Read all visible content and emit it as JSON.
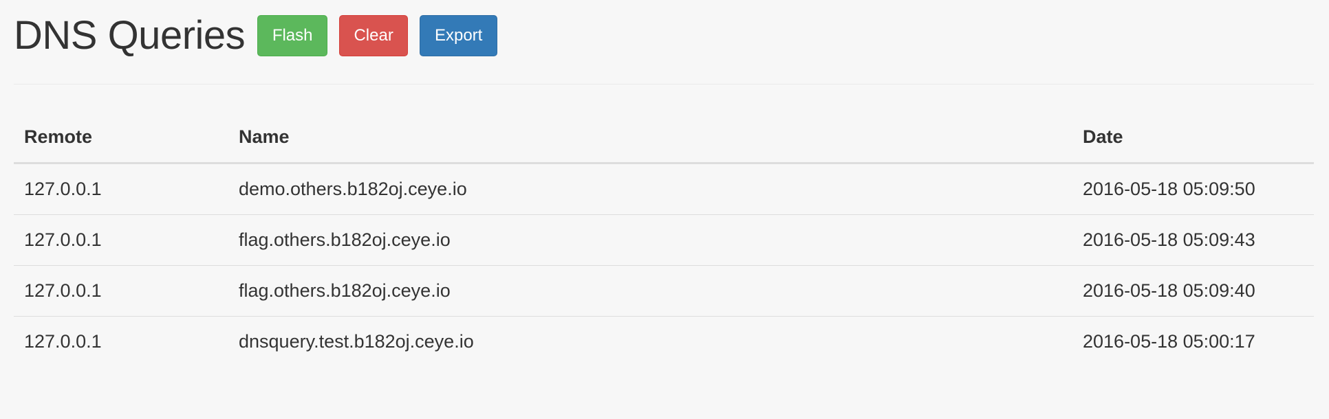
{
  "header": {
    "title": "DNS Queries",
    "buttons": {
      "flash_label": "Flash",
      "clear_label": "Clear",
      "export_label": "Export"
    }
  },
  "table": {
    "columns": [
      "Remote",
      "Name",
      "Date"
    ],
    "rows": [
      {
        "remote": "127.0.0.1",
        "name": "demo.others.b182oj.ceye.io",
        "date": "2016-05-18 05:09:50"
      },
      {
        "remote": "127.0.0.1",
        "name": "flag.others.b182oj.ceye.io",
        "date": "2016-05-18 05:09:43"
      },
      {
        "remote": "127.0.0.1",
        "name": "flag.others.b182oj.ceye.io",
        "date": "2016-05-18 05:09:40"
      },
      {
        "remote": "127.0.0.1",
        "name": "dnsquery.test.b182oj.ceye.io",
        "date": "2016-05-18 05:00:17"
      }
    ]
  },
  "colors": {
    "background": "#f7f7f7",
    "flash": "#5cb85c",
    "clear": "#d9534f",
    "export": "#337ab7"
  }
}
